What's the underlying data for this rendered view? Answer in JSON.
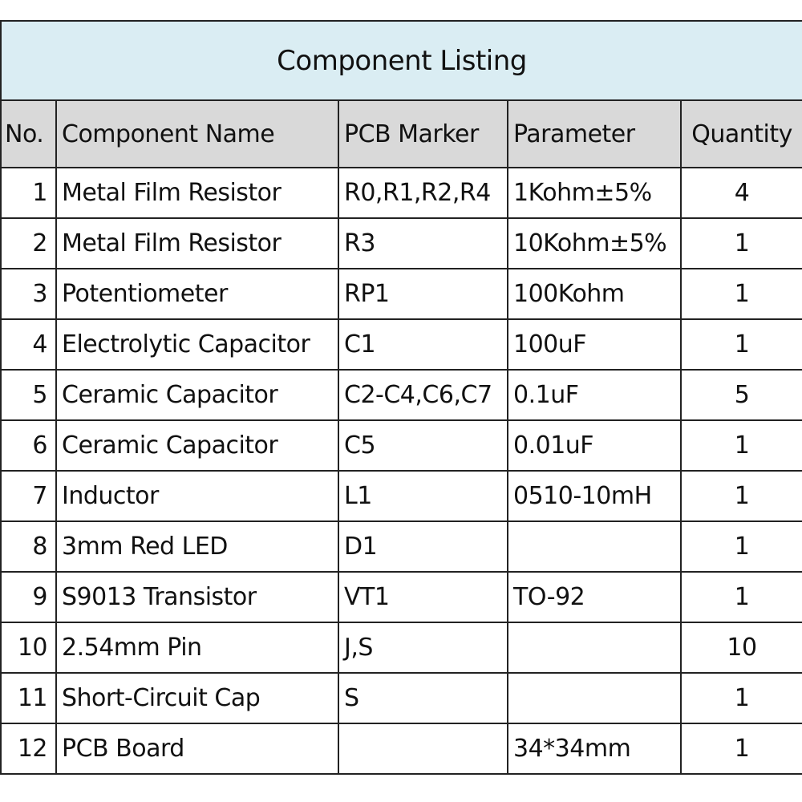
{
  "title": "Component Listing",
  "columns": {
    "no": "No.",
    "name": "Component Name",
    "marker": "PCB Marker",
    "parameter": "Parameter",
    "quantity": "Quantity"
  },
  "rows": [
    {
      "no": "1",
      "name": "Metal Film Resistor",
      "marker": "R0,R1,R2,R4",
      "parameter": "1Kohm±5%",
      "quantity": "4"
    },
    {
      "no": "2",
      "name": "Metal Film Resistor",
      "marker": "R3",
      "parameter": "10Kohm±5%",
      "quantity": "1"
    },
    {
      "no": "3",
      "name": "Potentiometer",
      "marker": "RP1",
      "parameter": "100Kohm",
      "quantity": "1"
    },
    {
      "no": "4",
      "name": "Electrolytic Capacitor",
      "marker": "C1",
      "parameter": "100uF",
      "quantity": "1"
    },
    {
      "no": "5",
      "name": "Ceramic Capacitor",
      "marker": "C2-C4,C6,C7",
      "parameter": "0.1uF",
      "quantity": "5"
    },
    {
      "no": "6",
      "name": "Ceramic Capacitor",
      "marker": "C5",
      "parameter": "0.01uF",
      "quantity": "1"
    },
    {
      "no": "7",
      "name": "Inductor",
      "marker": "L1",
      "parameter": "0510-10mH",
      "quantity": "1"
    },
    {
      "no": "8",
      "name": "3mm Red LED",
      "marker": "D1",
      "parameter": "",
      "quantity": "1"
    },
    {
      "no": "9",
      "name": "S9013 Transistor",
      "marker": "VT1",
      "parameter": "TO-92",
      "quantity": "1"
    },
    {
      "no": "10",
      "name": "2.54mm Pin",
      "marker": "J,S",
      "parameter": "",
      "quantity": "10"
    },
    {
      "no": "11",
      "name": "Short-Circuit Cap",
      "marker": "S",
      "parameter": "",
      "quantity": "1"
    },
    {
      "no": "12",
      "name": "PCB Board",
      "marker": "",
      "parameter": "34*34mm",
      "quantity": "1"
    }
  ],
  "colors": {
    "title_bg": "#daedf3",
    "header_bg": "#d9d9d9",
    "border": "#222222"
  }
}
